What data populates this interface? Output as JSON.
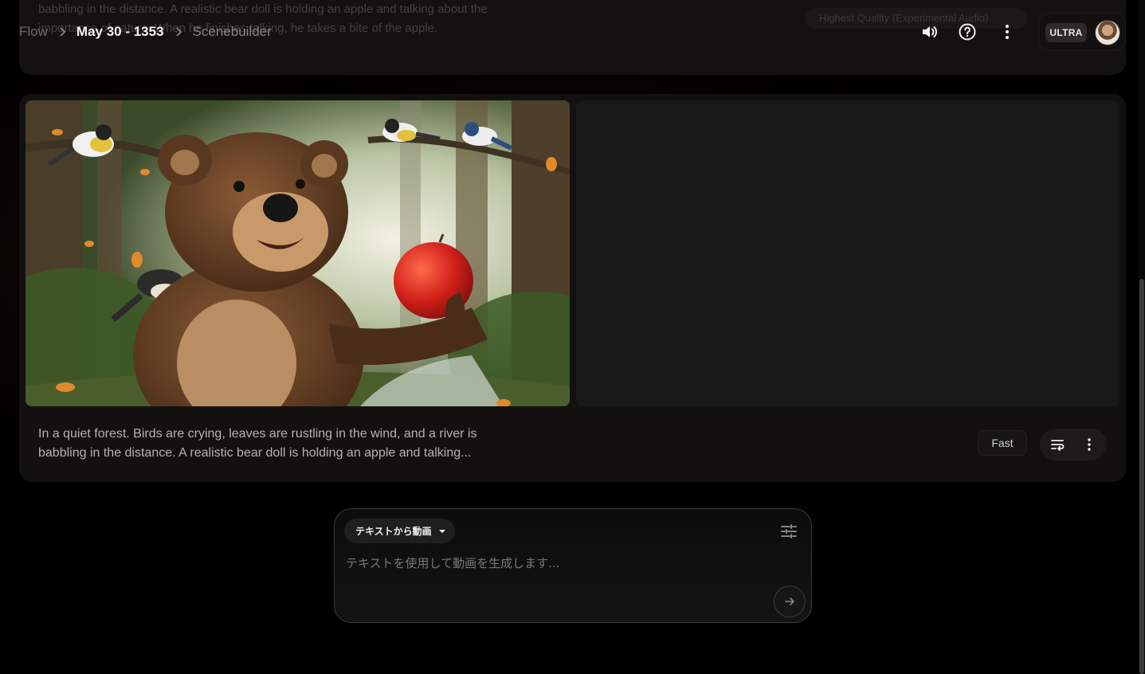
{
  "header": {
    "breadcrumb": [
      "Flow",
      "May 30 - 1353",
      "Scenebuilder"
    ],
    "account_badge": "ULTRA",
    "icons": [
      "volume-icon",
      "help-icon",
      "more-vert-icon"
    ]
  },
  "previous_card": {
    "text": "babbling in the distance. A realistic bear doll is holding an apple and talking about the importance of nature. When he finishes talking, he takes a bite of the apple.",
    "quality_label": "Highest Quality (Experimental Audio)"
  },
  "clip_card": {
    "caption": "In a quiet forest. Birds are crying, leaves are rustling in the wind, and a river is babbling in the distance. A realistic bear doll is holding an apple and talking...",
    "speed_label": "Fast"
  },
  "prompt": {
    "mode_label": "テキストから動画",
    "placeholder": "テキストを使用して動画を生成します..."
  },
  "colors": {
    "background": "#000000",
    "card": "#131110",
    "accent_text": "#f2f2f2"
  }
}
